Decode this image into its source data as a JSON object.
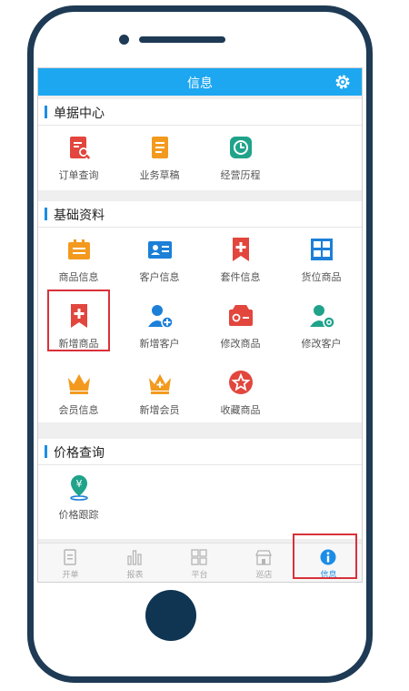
{
  "header": {
    "title": "信息",
    "settings_icon": "gear-icon"
  },
  "sections": [
    {
      "title": "单据中心",
      "items": [
        {
          "label": "订单查询",
          "icon": "order-search-icon"
        },
        {
          "label": "业务草稿",
          "icon": "draft-icon"
        },
        {
          "label": "经营历程",
          "icon": "history-clock-icon"
        }
      ]
    },
    {
      "title": "基础资料",
      "items": [
        {
          "label": "商品信息",
          "icon": "product-info-icon"
        },
        {
          "label": "客户信息",
          "icon": "customer-card-icon"
        },
        {
          "label": "套件信息",
          "icon": "bundle-bookmark-icon"
        },
        {
          "label": "货位商品",
          "icon": "shelf-icon"
        },
        {
          "label": "新增商品",
          "icon": "add-product-icon"
        },
        {
          "label": "新增客户",
          "icon": "add-customer-icon"
        },
        {
          "label": "修改商品",
          "icon": "edit-product-icon"
        },
        {
          "label": "修改客户",
          "icon": "edit-customer-icon"
        },
        {
          "label": "会员信息",
          "icon": "crown-icon"
        },
        {
          "label": "新增会员",
          "icon": "crown-plus-icon"
        },
        {
          "label": "收藏商品",
          "icon": "star-icon"
        }
      ]
    },
    {
      "title": "价格查询",
      "items": [
        {
          "label": "价格跟踪",
          "icon": "price-track-icon"
        }
      ]
    }
  ],
  "tabs": [
    {
      "label": "开单",
      "icon": "document-icon"
    },
    {
      "label": "报表",
      "icon": "bar-chart-icon"
    },
    {
      "label": "平台",
      "icon": "grid-icon"
    },
    {
      "label": "巡店",
      "icon": "store-icon"
    },
    {
      "label": "信息",
      "icon": "info-icon",
      "active": true
    }
  ],
  "colors": {
    "accent": "#1da7f0",
    "highlight": "#d9313a",
    "frame": "#1e3a55",
    "orange": "#f39a1e",
    "red": "#e2463d",
    "teal": "#1fa38a",
    "blue": "#1c7fd8"
  }
}
